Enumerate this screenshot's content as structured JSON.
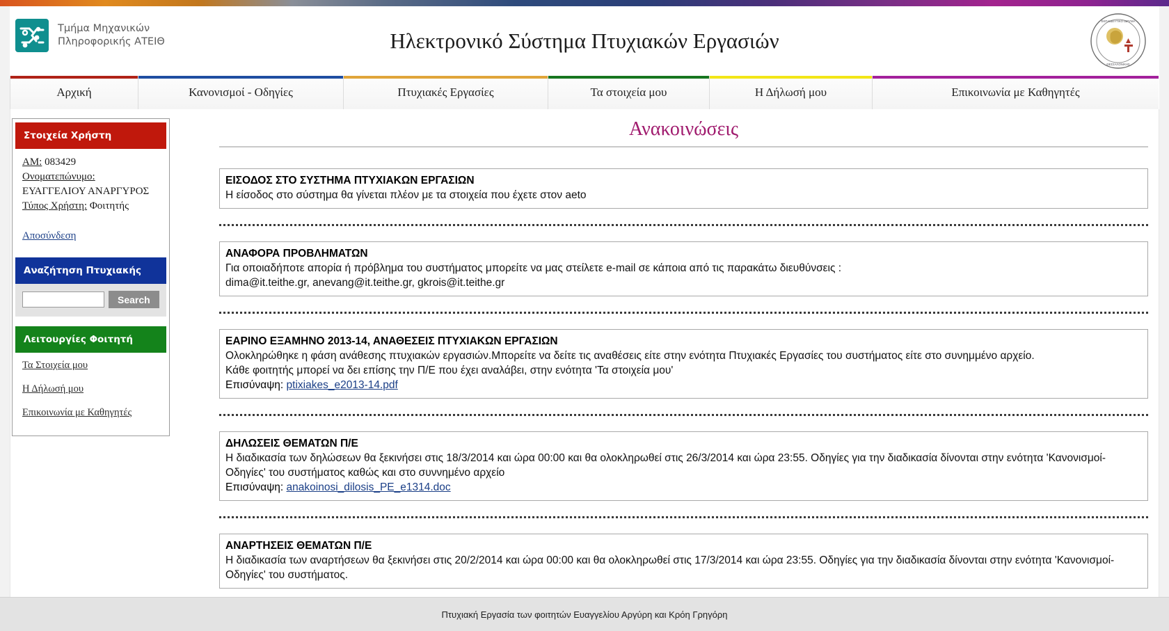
{
  "header": {
    "dept_name": "Τμήμα Μηχανικών\nΠληροφορικής ΑΤΕΙΘ",
    "title": "Ηλεκτρονικό Σύστημα Πτυχιακών Εργασιών",
    "seal_alt": "Αλεξάνδρειο Τεχνολογικό Εκπαιδευτικό Ίδρυμα Θεσσαλονίκης"
  },
  "nav": {
    "tabs": [
      {
        "label": "Αρχική",
        "accent": "#b02318"
      },
      {
        "label": "Κανονισμοί - Οδηγίες",
        "accent": "#1f4ea1"
      },
      {
        "label": "Πτυχιακές Εργασίες",
        "accent": "#e0a53a"
      },
      {
        "label": "Τα στοιχεία μου",
        "accent": "#17761f"
      },
      {
        "label": "Η Δήλωσή μου",
        "accent": "#f2e617"
      },
      {
        "label": "Επικοινωνία με Καθηγητές",
        "accent": "#a3219c"
      }
    ]
  },
  "sidebar": {
    "user_panel": {
      "heading": "Στοιχεία Χρήστη",
      "am_label": "ΑΜ:",
      "am_value": "083429",
      "name_label": "Ονοματεπώνυμο:",
      "name_value": "ΕΥΑΓΓΕΛΙΟΥ ΑΝΑΡΓΥΡΟΣ",
      "type_label": "Τύπος Χρήστη:",
      "type_value": "Φοιτητής",
      "logout_label": "Αποσύνδεση"
    },
    "search_panel": {
      "heading": "Αναζήτηση Πτυχιακής",
      "input_value": "",
      "input_placeholder": "",
      "button_label": "Search"
    },
    "functions_panel": {
      "heading": "Λειτουργίες Φοιτητή",
      "items": [
        "Τα Στοιχεία μου",
        "Η Δήλωσή μου",
        "Επικοινωνία με Καθηγητές"
      ]
    }
  },
  "main": {
    "title": "Ανακοινώσεις",
    "attachment_label": "Επισύναψη:",
    "announcements": [
      {
        "title": "ΕΙΣΟΔΟΣ ΣΤΟ ΣΥΣΤΗΜΑ ΠΤΥΧΙΑΚΩΝ ΕΡΓΑΣΙΩΝ",
        "lines": [
          "Η είσοδος στο σύστημα θα γίνεται πλέον με τα στοιχεία που έχετε στον aeto"
        ],
        "attachment": ""
      },
      {
        "title": "ΑΝΑΦΟΡΑ ΠΡΟΒΛΗΜΑΤΩΝ",
        "lines": [
          "Για οποιαδήποτε απορία ή πρόβλημα του συστήματος μπορείτε να μας στείλετε e-mail σε κάποια από τις παρακάτω διευθύνσεις :",
          "dima@it.teithe.gr, anevang@it.teithe.gr, gkrois@it.teithe.gr"
        ],
        "attachment": ""
      },
      {
        "title": "ΕΑΡΙΝΟ ΕΞΑΜΗΝΟ 2013-14, ΑΝΑΘΕΣΕΙΣ ΠΤΥΧΙΑΚΩΝ ΕΡΓΑΣΙΩΝ",
        "lines": [
          "Ολοκληρώθηκε η φάση ανάθεσης πτυχιακών εργασιών.Μπορείτε να δείτε τις αναθέσεις είτε στην ενότητα Πτυχιακές Εργασίες του συστήματος είτε στο συνημμένο αρχείο.",
          "Κάθε φοιτητής μπορεί να δει επίσης την Π/Ε που έχει αναλάβει, στην ενότητα 'Τα στοιχεία μου'"
        ],
        "attachment": "ptixiakes_e2013-14.pdf"
      },
      {
        "title": "ΔΗΛΩΣΕΙΣ ΘΕΜΑΤΩΝ Π/Ε",
        "lines": [
          "Η διαδικασία των δηλώσεων θα ξεκινήσει στις 18/3/2014 και ώρα 00:00 και θα ολοκληρωθεί στις 26/3/2014 και ώρα 23:55. Οδηγίες για την διαδικασία δίνονται στην ενότητα 'Κανονισμοί-Οδηγίες' του συστήματος καθώς και στο συννημένο αρχείο"
        ],
        "attachment": "anakoinosi_dilosis_PE_e1314.doc"
      },
      {
        "title": "ΑΝΑΡΤΗΣΕΙΣ ΘΕΜΑΤΩΝ Π/Ε",
        "lines": [
          "Η διαδικασία των αναρτήσεων θα ξεκινήσει στις 20/2/2014 και ώρα 00:00 και θα ολοκληρωθεί στις 17/3/2014 και ώρα 23:55. Οδηγίες για την διαδικασία δίνονται στην ενότητα 'Κανονισμοί-Οδηγίες' του συστήματος."
        ],
        "attachment": ""
      }
    ]
  },
  "footer": {
    "text": "Πτυχιακή Εργασία των φοιτητών Ευαγγελίου Αργύρη και Κρόη Γρηγόρη"
  }
}
